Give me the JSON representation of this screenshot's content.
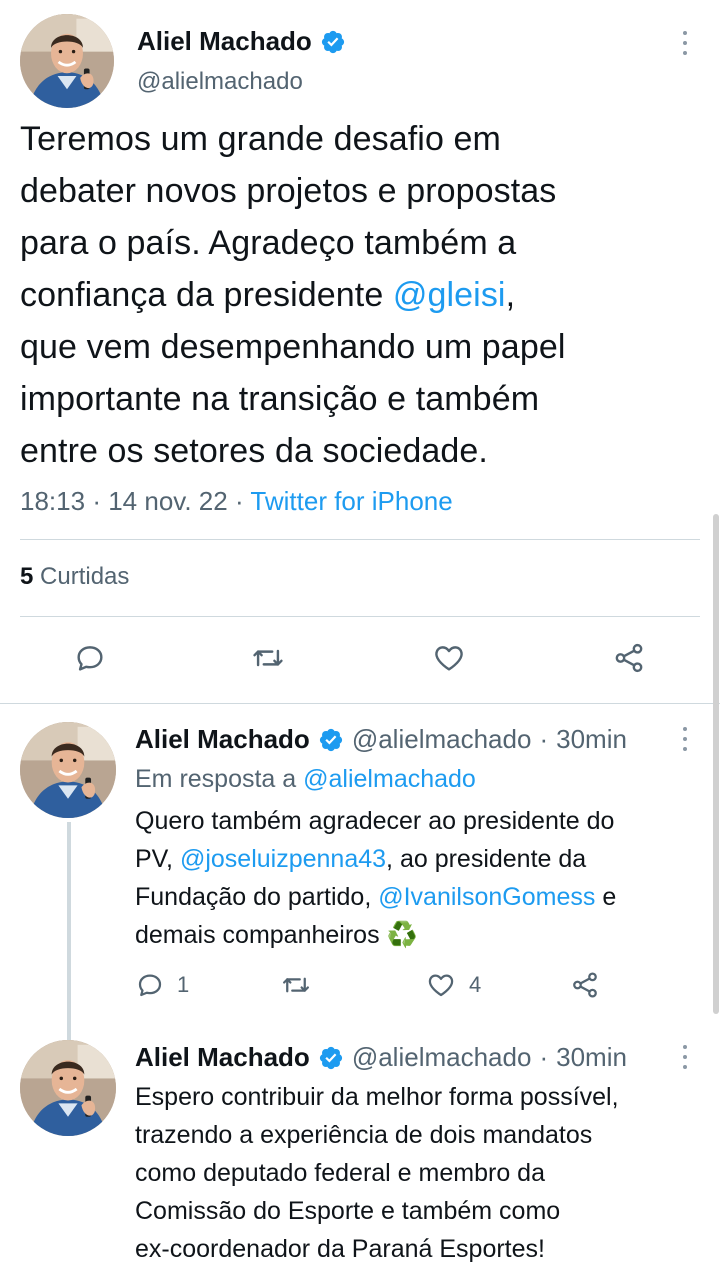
{
  "main_tweet": {
    "author_name": "Aliel Machado",
    "author_handle": "@alielmachado",
    "text_before_mention": "Teremos um grande desafio em\ndebater novos projetos e propostas\npara o país. Agradeço também a\nconfiança da presidente ",
    "mention": "@gleisi",
    "text_after_mention": ",\nque vem desempenhando um papel\nimportante na transição e também\nentre os setores da sociedade.",
    "time": "18:13",
    "date": "14 nov. 22",
    "source": "Twitter for iPhone",
    "likes_count": "5",
    "likes_label": "Curtidas"
  },
  "replies": [
    {
      "author_name": "Aliel Machado",
      "author_handle": "@alielmachado",
      "time_ago": "30min",
      "in_reply_prefix": "Em resposta a ",
      "in_reply_handle": "@alielmachado",
      "text_1": "Quero também agradecer ao presidente do\nPV, ",
      "mention_1": "@joseluizpenna43",
      "text_2": ", ao presidente da\nFundação do partido, ",
      "mention_2": "@IvanilsonGomess",
      "text_3": " e\ndemais companheiros ",
      "emoji": "♻️",
      "reply_count": "1",
      "like_count": "4"
    },
    {
      "author_name": "Aliel Machado",
      "author_handle": "@alielmachado",
      "time_ago": "30min",
      "text": "Espero contribuir da melhor forma possível,\ntrazendo a experiência de dois mandatos\ncomo deputado federal e membro da\nComissão do Esporte e também como\nex-coordenador da Paraná Esportes!"
    }
  ],
  "separators": {
    "dot": "·"
  },
  "icons": {
    "verified": "verified-badge-icon",
    "more": "more-vertical-icon",
    "reply": "reply-icon",
    "retweet": "retweet-icon",
    "like": "heart-icon",
    "share": "share-icon"
  },
  "colors": {
    "link": "#1d9bf0",
    "secondary_text": "#536471",
    "primary_text": "#0f1419",
    "divider": "#cfd9de"
  }
}
